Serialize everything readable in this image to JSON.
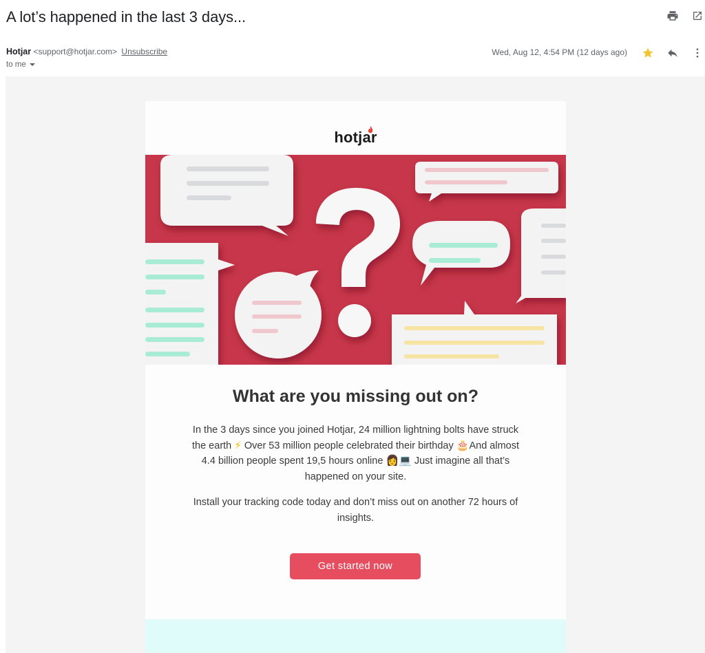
{
  "email": {
    "subject": "A lot’s happened in the last 3 days...",
    "sender_name": "Hotjar",
    "sender_email": "<support@hotjar.com>",
    "unsubscribe_label": "Unsubscribe",
    "recipient_label": "to me",
    "date": "Wed, Aug 12, 4:54 PM (12 days ago)",
    "starred": true,
    "icons": [
      "print-icon",
      "open-in-new-icon",
      "star-icon",
      "reply-icon",
      "more-vert-icon",
      "chevron-down-icon"
    ]
  },
  "body": {
    "logo_text": "hotjar",
    "headline": "What are you missing out on?",
    "para1": {
      "line1": "In the 3 days since you joined Hotjar, 24 million lightning bolts have struck",
      "line2a": "the earth",
      "bolt": "⚡",
      "line2b": "Over 53 million people celebrated their birthday",
      "cake": "🎂",
      "line2c": "And almost",
      "line3a": "4.4 billion people spent 19,5 hours online",
      "woman": "👩",
      "computer": "💻",
      "line3b": "Just imagine all that’s",
      "line4": "happened on your site."
    },
    "para2": "Install your tracking code today and don’t miss out on another 72 hours of insights.",
    "cta_label": "Get started now"
  },
  "colors": {
    "hero_bg": "#c7364a",
    "cta": "#e64e60",
    "teal_band": "#dffcfb",
    "star": "#f4c430",
    "brand_flame": "#e8443a"
  }
}
